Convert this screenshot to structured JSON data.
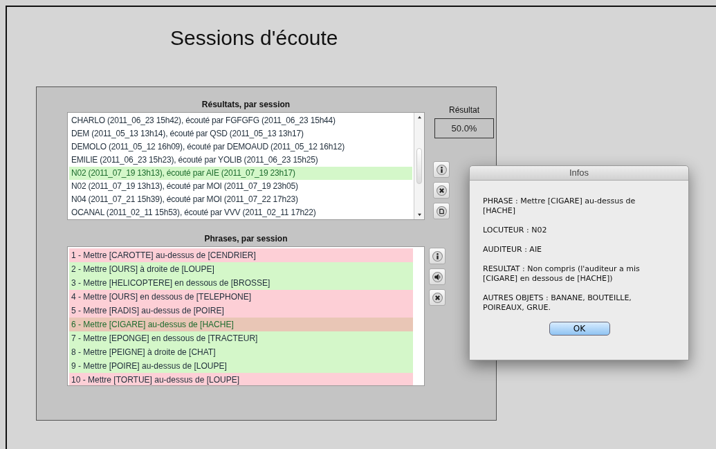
{
  "title": "Sessions d'écoute",
  "results": {
    "heading": "Résultats, par session",
    "rows": [
      {
        "text": "CHARLO (2011_06_23 15h42), écouté par FGFGFG (2011_06_23 15h44)",
        "selected": false
      },
      {
        "text": "DEM (2011_05_13 13h14), écouté par QSD (2011_05_13 13h17)",
        "selected": false
      },
      {
        "text": "DEMOLO (2011_05_12 16h09), écouté par DEMOAUD (2011_05_12 16h12)",
        "selected": false
      },
      {
        "text": "EMILIE (2011_06_23 15h23), écouté par YOLIB (2011_06_23 15h25)",
        "selected": false
      },
      {
        "text": "N02 (2011_07_19 13h13), écouté par AIE (2011_07_19 23h17)",
        "selected": true
      },
      {
        "text": "N02 (2011_07_19 13h13), écouté par MOI (2011_07_19 23h05)",
        "selected": false
      },
      {
        "text": "N04 (2011_07_21 15h39), écouté par MOI (2011_07_22 17h23)",
        "selected": false
      },
      {
        "text": "OCANAL (2011_02_11 15h53), écouté par VVV (2011_02_11 17h22)",
        "selected": false
      }
    ]
  },
  "result": {
    "label": "Résultat",
    "value": "50.0%"
  },
  "session_buttons": [
    {
      "kind": "info"
    },
    {
      "kind": "delete"
    },
    {
      "kind": "export"
    }
  ],
  "phrases": {
    "heading": "Phrases, par session",
    "rows": [
      {
        "text": "1 - Mettre [CAROTTE] au-dessus de [CENDRIER]",
        "kind": "wrong",
        "selected": false
      },
      {
        "text": "2 - Mettre [OURS] à droite de [LOUPE]",
        "kind": "right",
        "selected": false
      },
      {
        "text": "3 - Mettre [HELICOPTERE] en dessous de [BROSSE]",
        "kind": "right",
        "selected": false
      },
      {
        "text": "4 - Mettre [OURS] en dessous de [TELEPHONE]",
        "kind": "wrong",
        "selected": false
      },
      {
        "text": "5 - Mettre [RADIS] au-dessus de [POIRE]",
        "kind": "wrong",
        "selected": false
      },
      {
        "text": "6 - Mettre [CIGARE] au-dessus de [HACHE]",
        "kind": "wrong",
        "selected": true
      },
      {
        "text": "7 - Mettre [EPONGE] en dessous de [TRACTEUR]",
        "kind": "right",
        "selected": false
      },
      {
        "text": "8 - Mettre [PEIGNE] à droite de [CHAT]",
        "kind": "right",
        "selected": false
      },
      {
        "text": "9 - Mettre [POIRE] au-dessus de [LOUPE]",
        "kind": "right",
        "selected": false
      },
      {
        "text": "10 - Mettre [TORTUE] au-dessus de [LOUPE]",
        "kind": "wrong",
        "selected": false
      }
    ]
  },
  "phrase_buttons": [
    {
      "kind": "info"
    },
    {
      "kind": "sound"
    },
    {
      "kind": "delete"
    }
  ],
  "dialog": {
    "title": "Infos",
    "lines": [
      "PHRASE : Mettre [CIGARE] au-dessus de [HACHE]",
      "LOCUTEUR : N02",
      "AUDITEUR : AIE",
      "RESULTAT : Non compris (l'auditeur a mis [CIGARE] en dessous de [HACHE])",
      "AUTRES OBJETS : BANANE, BOUTEILLE, POIREAUX, GRUE."
    ],
    "button": "OK"
  }
}
